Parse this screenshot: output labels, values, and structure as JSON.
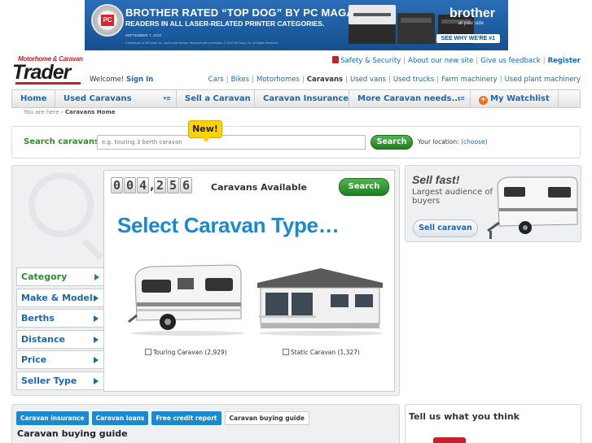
{
  "ad": {
    "headline": "BROTHER RATED “TOP DOG” BY PC MAGAZINE",
    "subline": "READERS IN ALL LASER-RELATED PRINTER CATEGORIES.",
    "date": "SEPTEMBER 7, 2010",
    "fine_print": "A trademark of Ziff Davis, Inc. Used under license. Reprinted with permission. © 2010 Ziff Davis, Inc. All Rights Reserved.",
    "badge_text": "PC",
    "brand": "brother",
    "tagline": "at your side",
    "cta": "SEE WHY WE'RE #1"
  },
  "logo": {
    "line1": "Motorhome & Caravan",
    "line2": "Trader"
  },
  "welcome": {
    "text": "Welcome!",
    "signin": "Sign In"
  },
  "toplinks": {
    "safety": "Safety & Security",
    "new_site": "About our new site",
    "feedback": "Give us feedback",
    "register": "Register"
  },
  "catlinks": [
    "Cars",
    "Bikes",
    "Motorhomes",
    "Caravans",
    "Used vans",
    "Used trucks",
    "Farm machinery",
    "Used plant machinery"
  ],
  "nav": {
    "home": "Home",
    "used_caravans": "Used Caravans",
    "sell": "Sell a Caravan",
    "insurance": "Caravan Insurance",
    "more": "More Caravan needs...",
    "watchlist": "My Watchlist"
  },
  "breadcrumb": {
    "prefix": "You are here",
    "current": "Caravans Home"
  },
  "search": {
    "label": "Search caravans:",
    "placeholder": "e.g. touring 3 berth caravan",
    "button": "Search",
    "location_label": "Your location:",
    "location_link": "(choose)",
    "new_badge": "New!"
  },
  "filters": [
    "Category",
    "Make & Model",
    "Berths",
    "Distance",
    "Price",
    "Seller Type"
  ],
  "counter": {
    "digits": [
      "0",
      "0",
      "4",
      "2",
      "5",
      "6"
    ],
    "label": "Caravans Available",
    "button": "Search"
  },
  "select_title": "Select Caravan Type…",
  "types": [
    {
      "label": "Touring Caravan (2,929)"
    },
    {
      "label": "Static Caravan (1,327)"
    }
  ],
  "sell": {
    "title": "Sell fast!",
    "subtitle": "Largest audience of buyers",
    "button": "Sell caravan"
  },
  "bottom": {
    "tabs": [
      "Caravan insurance",
      "Caravan loans",
      "Free credit report",
      "Caravan buying guide"
    ],
    "guide_title": "Caravan buying guide",
    "guide_text": ""
  },
  "tell": {
    "title": "Tell us what you think"
  }
}
